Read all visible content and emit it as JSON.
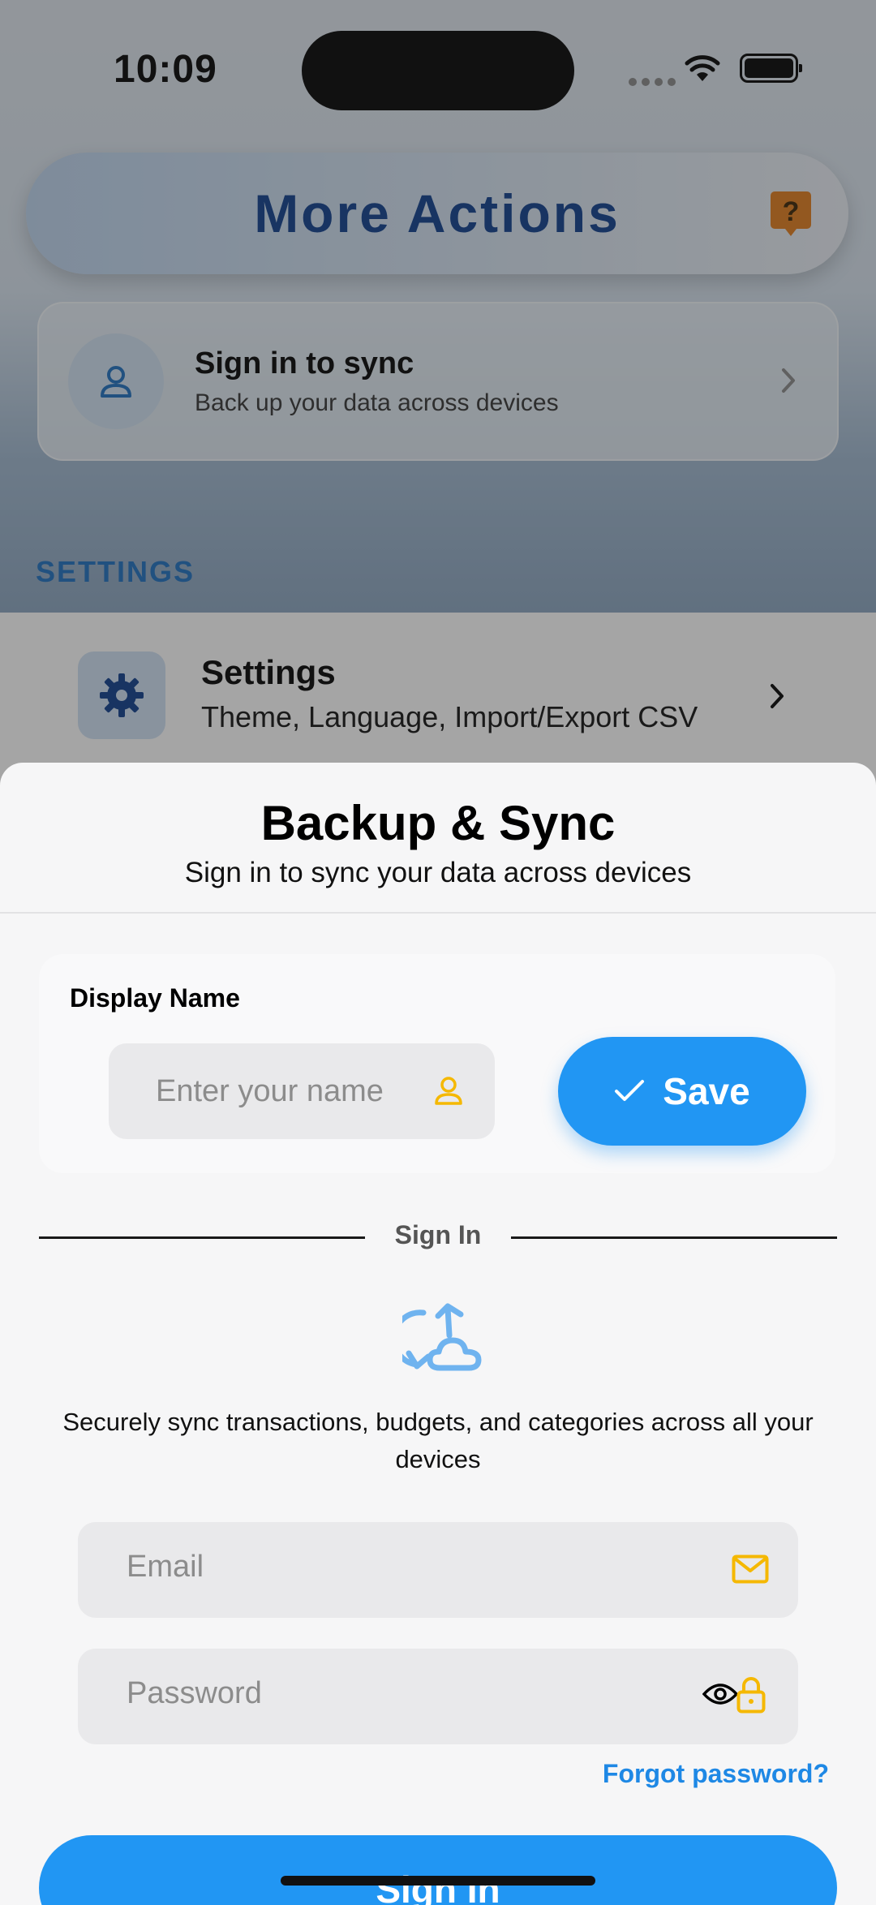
{
  "status_bar": {
    "time": "10:09"
  },
  "background": {
    "header_title": "More Actions",
    "help_icon": "question-bubble-icon",
    "sync_card": {
      "title": "Sign in to sync",
      "subtitle": "Back up your data across devices"
    },
    "section_label": "SETTINGS",
    "settings_row": {
      "title": "Settings",
      "subtitle": "Theme, Language, Import/Export CSV"
    }
  },
  "sheet": {
    "title": "Backup & Sync",
    "subtitle": "Sign in to sync your data across devices",
    "display_name": {
      "label": "Display Name",
      "placeholder": "Enter your name",
      "value": "",
      "save_label": "Save"
    },
    "divider_text": "Sign In",
    "description": "Securely sync transactions, budgets, and categories across all your devices",
    "email": {
      "placeholder": "Email",
      "value": ""
    },
    "password": {
      "placeholder": "Password",
      "value": ""
    },
    "forgot_label": "Forgot password?",
    "signin_label": "Sign In"
  },
  "colors": {
    "accent": "#2196f3",
    "title_blue": "#0d3d8c",
    "icon_yellow": "#f5b800",
    "icon_light_blue": "#6fb3ef"
  }
}
